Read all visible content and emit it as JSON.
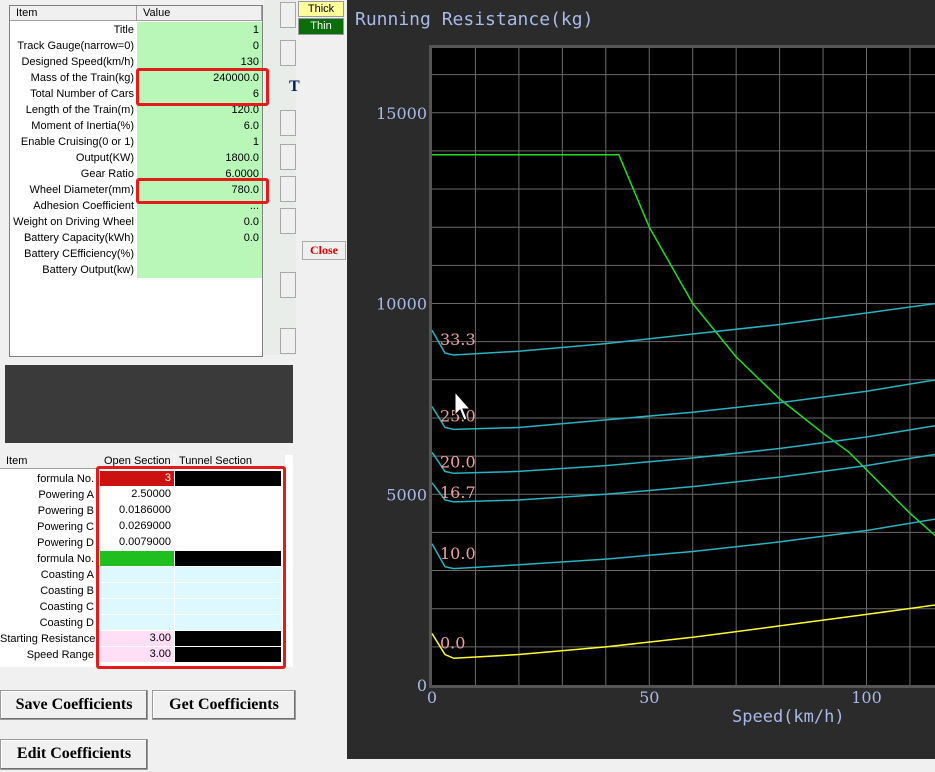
{
  "param_grid": {
    "columns": [
      "Item",
      "Value"
    ],
    "rows": [
      {
        "label": "Title",
        "value": "1"
      },
      {
        "label": "Track Gauge(narrow=0)",
        "value": "0"
      },
      {
        "label": "Designed Speed(km/h)",
        "value": "130"
      },
      {
        "label": "Mass of the Train(kg)",
        "value": "240000.0"
      },
      {
        "label": "Total Number of Cars",
        "value": "6"
      },
      {
        "label": "Length of the Train(m)",
        "value": "120.0"
      },
      {
        "label": "Moment of Inertia(%)",
        "value": "6.0"
      },
      {
        "label": "Enable Cruising(0 or 1)",
        "value": "1"
      },
      {
        "label": "Output(KW)",
        "value": "1800.0"
      },
      {
        "label": "Gear Ratio",
        "value": "6.0000"
      },
      {
        "label": "Wheel Diameter(mm)",
        "value": "780.0"
      },
      {
        "label": "Adhesion Coefficient",
        "value": "..."
      },
      {
        "label": "Weight on Driving Wheel",
        "value": "0.0"
      },
      {
        "label": "Battery Capacity(kWh)",
        "value": "0.0"
      },
      {
        "label": "Battery CEfficiency(%)",
        "value": ""
      },
      {
        "label": "Battery Output(kw)",
        "value": ""
      }
    ]
  },
  "coef_grid": {
    "columns": [
      "Item",
      "Open Section",
      "Tunnel Section"
    ],
    "rows": [
      {
        "label": "formula No.",
        "open": "3",
        "open_bg": "#cc1111",
        "open_color": "#ffffff",
        "tunnel_bg": "#000000"
      },
      {
        "label": "Powering A",
        "open": "2.50000",
        "open_bg": "#ffffff",
        "open_color": "#000000",
        "tunnel_bg": "#ffffff"
      },
      {
        "label": "Powering B",
        "open": "0.0186000",
        "open_bg": "#ffffff",
        "open_color": "#000000",
        "tunnel_bg": "#ffffff"
      },
      {
        "label": "Powering C",
        "open": "0.0269000",
        "open_bg": "#ffffff",
        "open_color": "#000000",
        "tunnel_bg": "#ffffff"
      },
      {
        "label": "Powering D",
        "open": "0.0079000",
        "open_bg": "#ffffff",
        "open_color": "#000000",
        "tunnel_bg": "#ffffff"
      },
      {
        "label": "formula No.",
        "open": "",
        "open_bg": "#1fbf1f",
        "open_color": "#000000",
        "tunnel_bg": "#000000"
      },
      {
        "label": "Coasting A",
        "open": "",
        "open_bg": "#ddf9ff",
        "open_color": "#000000",
        "tunnel_bg": "#ddf9ff"
      },
      {
        "label": "Coasting B",
        "open": "",
        "open_bg": "#ddf9ff",
        "open_color": "#000000",
        "tunnel_bg": "#ddf9ff"
      },
      {
        "label": "Coasting C",
        "open": "",
        "open_bg": "#ddf9ff",
        "open_color": "#000000",
        "tunnel_bg": "#ddf9ff"
      },
      {
        "label": "Coasting D",
        "open": "",
        "open_bg": "#ddf9ff",
        "open_color": "#000000",
        "tunnel_bg": "#ddf9ff"
      },
      {
        "label": "Starting Resistance",
        "open": "3.00",
        "open_bg": "#ffdff5",
        "open_color": "#000000",
        "tunnel_bg": "#000000"
      },
      {
        "label": "Speed Range",
        "open": "3.00",
        "open_bg": "#ffdff5",
        "open_color": "#000000",
        "tunnel_bg": "#000000"
      }
    ]
  },
  "buttons": {
    "save": "Save Coefficients",
    "get": "Get Coefficients",
    "edit": "Edit Coefficients",
    "thick": "Thick",
    "thin": "Thin",
    "close": "Close",
    "t_char": "T"
  },
  "colors": {
    "accent_red": "#e41b1b",
    "tractive_line": "#22dd22",
    "resistance_line": "#2ab3c0",
    "level_line": "#ffff33",
    "chart_bg": "#000000"
  },
  "chart_data": {
    "type": "line",
    "title": "Running Resistance(kg)",
    "xlabel": "Speed(km/h)",
    "ylabel": "",
    "x_ticks": [
      0,
      50,
      100
    ],
    "y_ticks": [
      0,
      5000,
      10000,
      15000
    ],
    "xlim": [
      0,
      116
    ],
    "ylim": [
      0,
      16800
    ],
    "grid": true,
    "series": [
      {
        "label": "",
        "color": "#22dd22",
        "points": [
          [
            0,
            13900
          ],
          [
            43,
            13900
          ],
          [
            50,
            12000
          ],
          [
            60,
            10000
          ],
          [
            70,
            8600
          ],
          [
            80,
            7500
          ],
          [
            90,
            6600
          ],
          [
            96,
            6100
          ],
          [
            110,
            4500
          ],
          [
            116,
            3900
          ]
        ]
      },
      {
        "label": "33.3",
        "color": "#2ab3c0",
        "points": [
          [
            0,
            9300
          ],
          [
            3,
            8700
          ],
          [
            5,
            8650
          ],
          [
            20,
            8750
          ],
          [
            40,
            8950
          ],
          [
            60,
            9200
          ],
          [
            80,
            9450
          ],
          [
            100,
            9750
          ],
          [
            116,
            10000
          ]
        ]
      },
      {
        "label": "25.0",
        "color": "#2ab3c0",
        "points": [
          [
            0,
            7300
          ],
          [
            3,
            6750
          ],
          [
            5,
            6700
          ],
          [
            20,
            6750
          ],
          [
            40,
            6950
          ],
          [
            60,
            7150
          ],
          [
            80,
            7400
          ],
          [
            100,
            7700
          ],
          [
            116,
            8000
          ]
        ]
      },
      {
        "label": "20.0",
        "color": "#2ab3c0",
        "points": [
          [
            0,
            6100
          ],
          [
            3,
            5600
          ],
          [
            5,
            5550
          ],
          [
            20,
            5600
          ],
          [
            40,
            5750
          ],
          [
            60,
            5950
          ],
          [
            80,
            6200
          ],
          [
            100,
            6500
          ],
          [
            116,
            6800
          ]
        ]
      },
      {
        "label": "16.7",
        "color": "#2ab3c0",
        "points": [
          [
            0,
            5300
          ],
          [
            3,
            4850
          ],
          [
            5,
            4800
          ],
          [
            20,
            4850
          ],
          [
            40,
            5000
          ],
          [
            60,
            5200
          ],
          [
            80,
            5450
          ],
          [
            100,
            5750
          ],
          [
            116,
            6050
          ]
        ]
      },
      {
        "label": "10.0",
        "color": "#2ab3c0",
        "points": [
          [
            0,
            3700
          ],
          [
            3,
            3100
          ],
          [
            5,
            3050
          ],
          [
            20,
            3150
          ],
          [
            40,
            3300
          ],
          [
            60,
            3500
          ],
          [
            80,
            3750
          ],
          [
            100,
            4050
          ],
          [
            116,
            4350
          ]
        ]
      },
      {
        "label": "0.0",
        "color": "#ffff33",
        "points": [
          [
            0,
            1350
          ],
          [
            3,
            800
          ],
          [
            5,
            700
          ],
          [
            20,
            800
          ],
          [
            40,
            1000
          ],
          [
            60,
            1250
          ],
          [
            80,
            1550
          ],
          [
            100,
            1850
          ],
          [
            116,
            2100
          ]
        ]
      }
    ]
  }
}
